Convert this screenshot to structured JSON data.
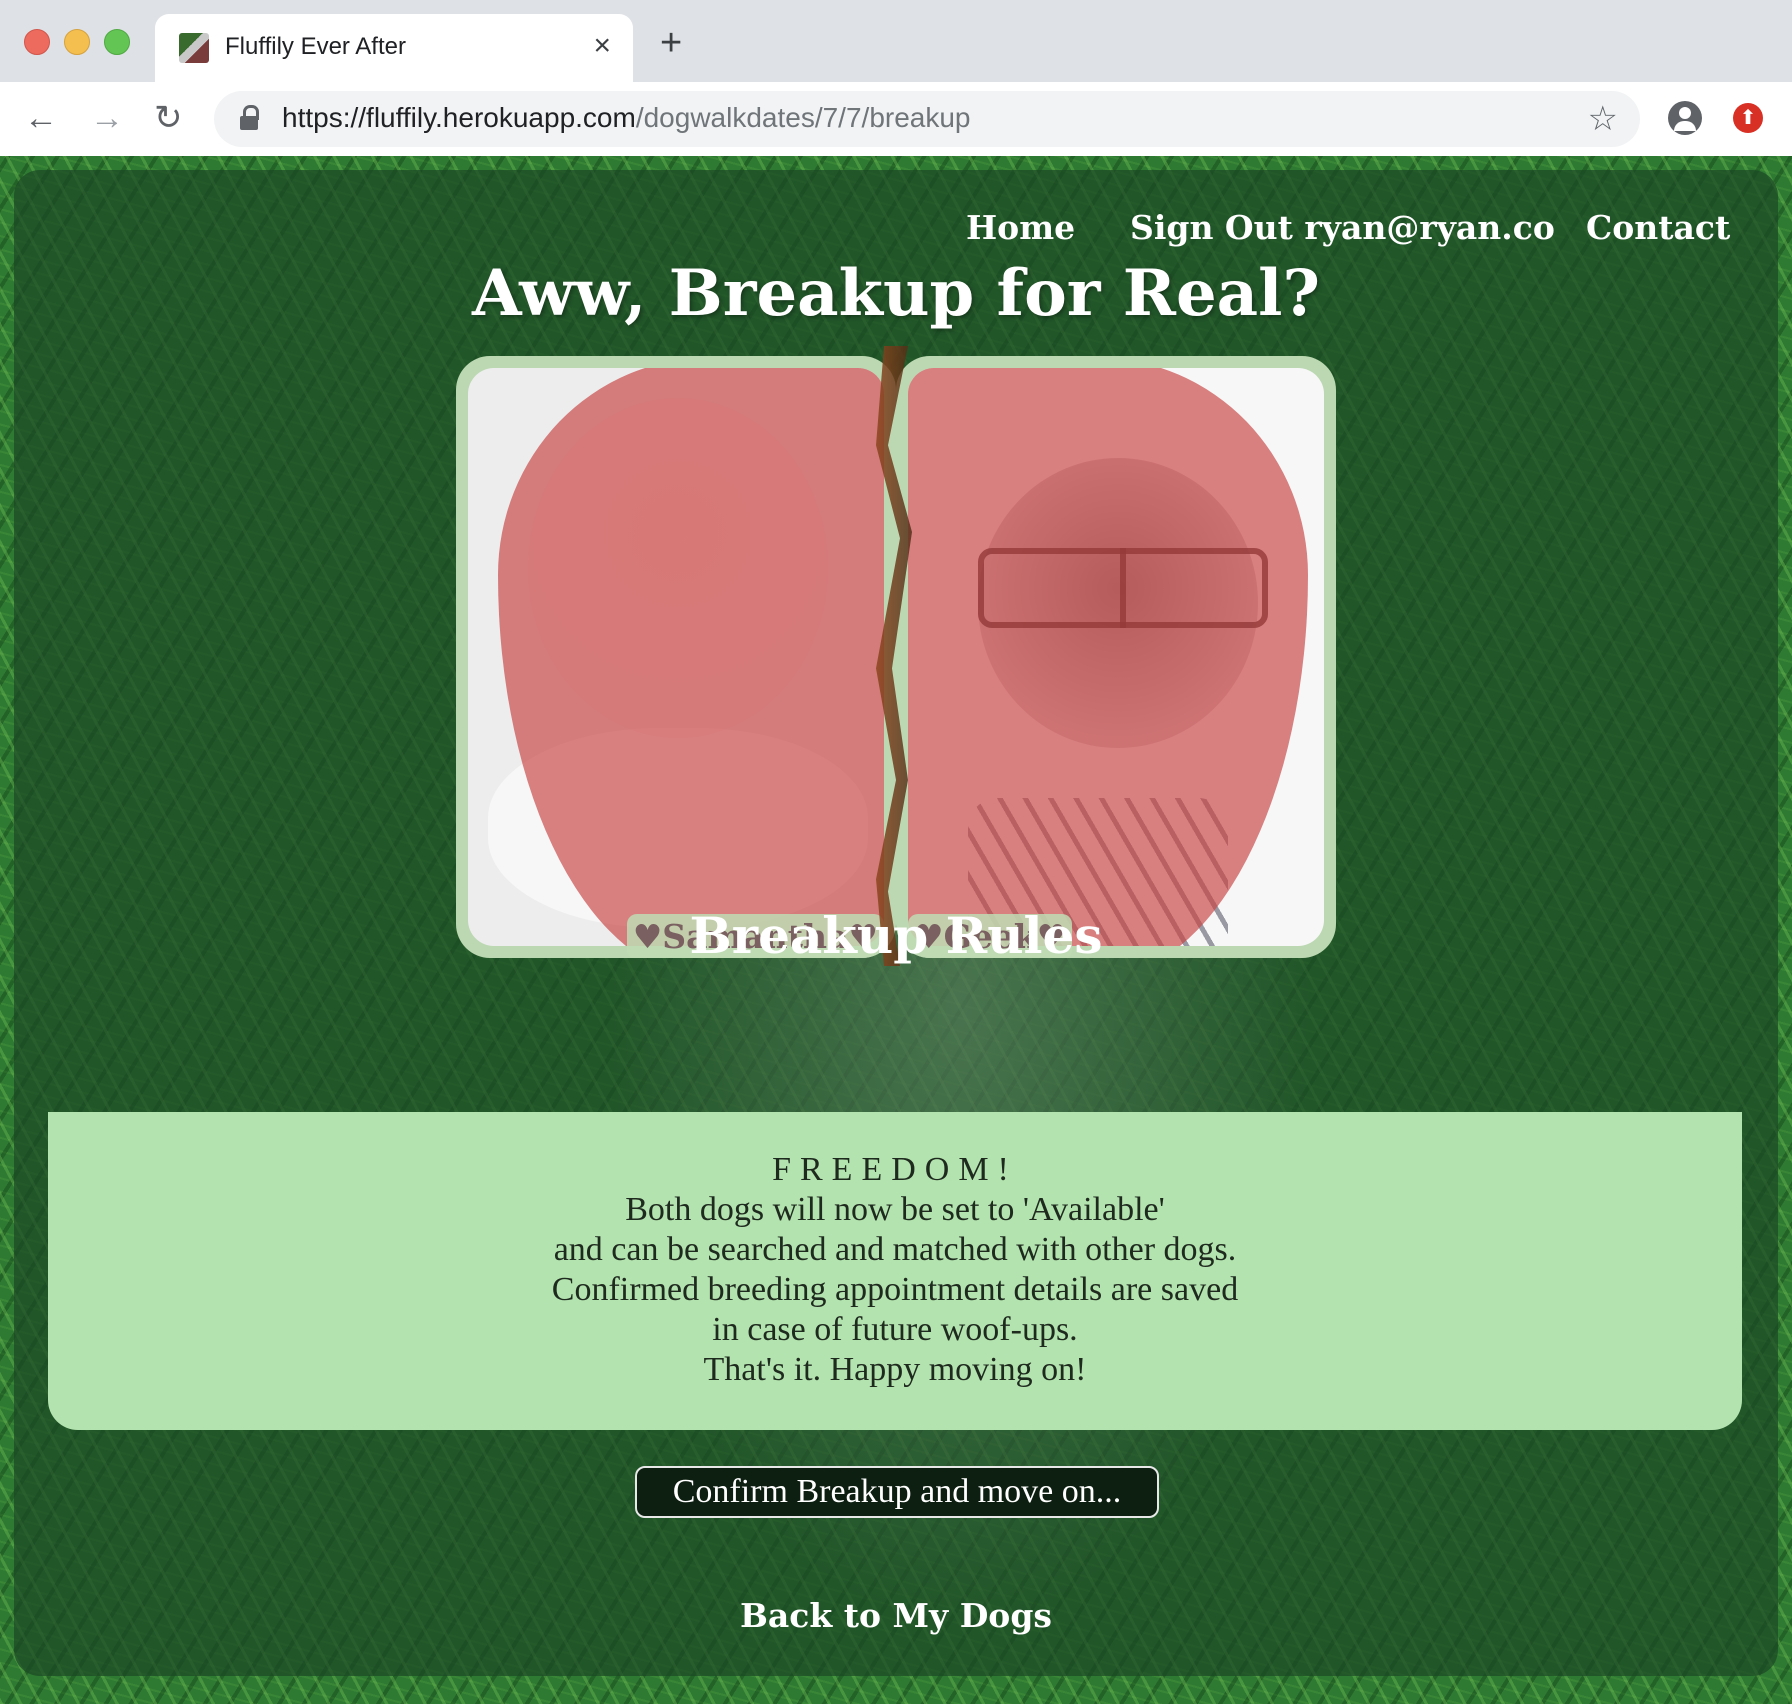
{
  "browser": {
    "tab_title": "Fluffily Ever After",
    "tab_close": "×",
    "new_tab": "+",
    "url_host": "https://fluffily.herokuapp.com",
    "url_path": "/dogwalkdates/7/7/breakup",
    "back": "←",
    "forward": "→",
    "reload": "↻",
    "bookmark": "☆",
    "extension": "⬆"
  },
  "nav": {
    "home": "Home",
    "sign_out": "Sign Out ryan@ryan.co",
    "contact": "Contact"
  },
  "page": {
    "headline": "Aww, Breakup for Real?",
    "dog_left_name": "♥Samantha♥",
    "dog_right_name": "♥Geek♥",
    "rules_title": "Breakup Rules",
    "rules_lines": [
      "FREEDOM!",
      "Both dogs will now be set to 'Available'",
      "and can be searched and matched with other dogs.",
      "Confirmed breeding appointment details are saved",
      "in case of future woof-ups.",
      "That's it. Happy moving on!"
    ],
    "confirm_button": "Confirm Breakup and move on...",
    "back_link": "Back to My Dogs"
  },
  "colors": {
    "rules_box": "#b3e3ae",
    "heart": "#c84646",
    "panel": "#1c4826"
  }
}
